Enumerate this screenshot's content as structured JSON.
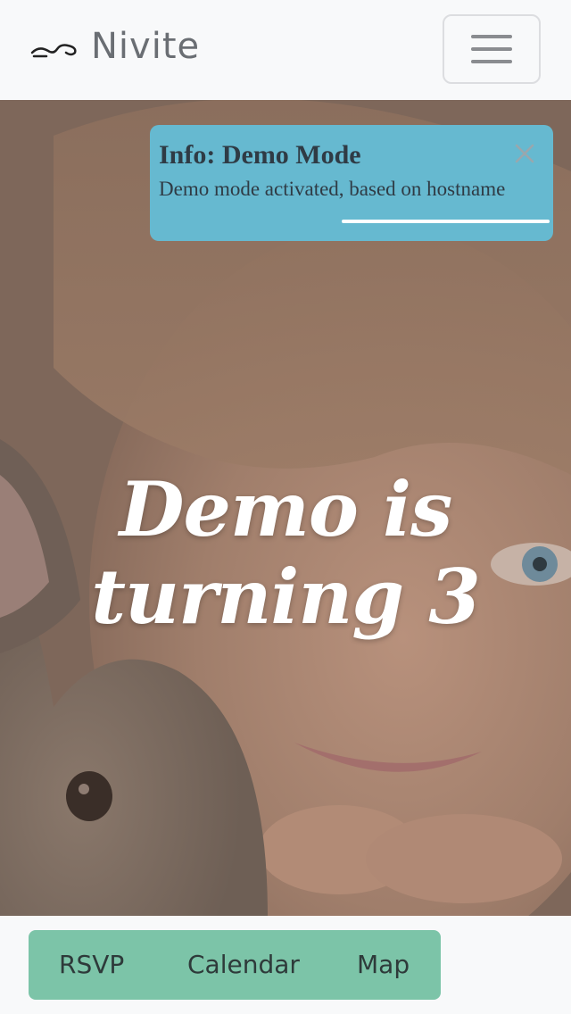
{
  "navbar": {
    "brand": "Nivite",
    "logo_icon": "swirl-logo-icon",
    "menu_icon": "hamburger-menu-icon"
  },
  "toast": {
    "title": "Info: Demo Mode",
    "message": "Demo mode activated, based on hostname",
    "close_icon": "close-icon",
    "background": "#66b9d0",
    "progress": 0.52
  },
  "hero": {
    "title_line1": "Demo is",
    "title_line2": "turning 3"
  },
  "actions": {
    "background": "#7cc4a8",
    "items": [
      {
        "label": "RSVP"
      },
      {
        "label": "Calendar"
      },
      {
        "label": "Map"
      }
    ]
  }
}
